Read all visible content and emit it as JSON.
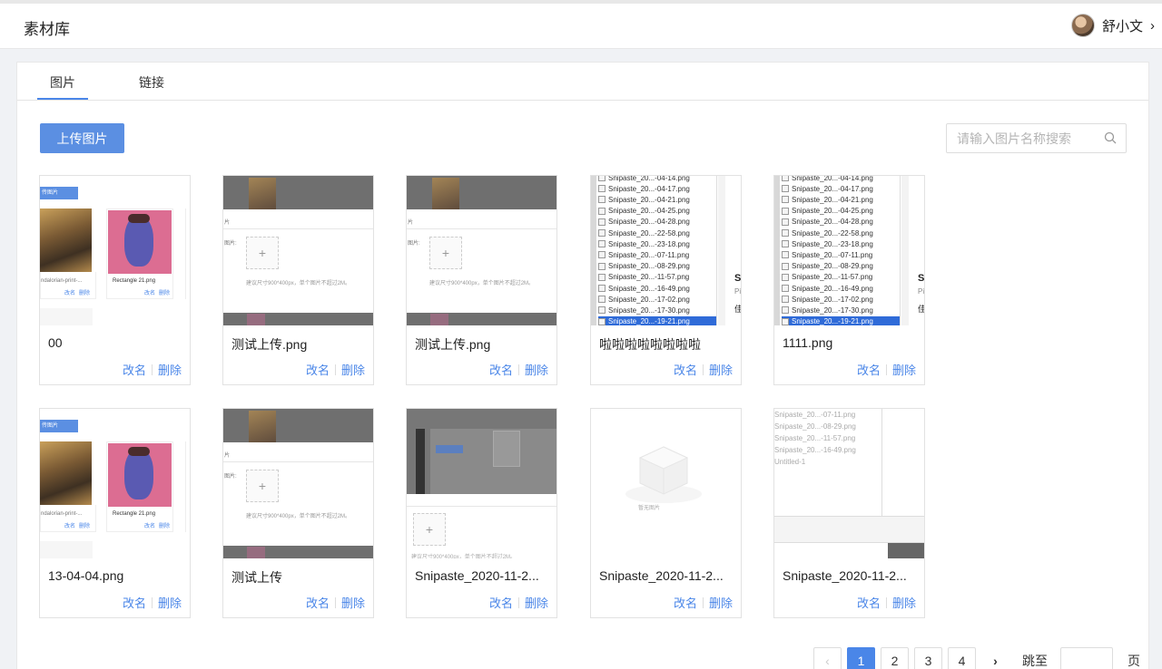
{
  "app": {
    "title": "素材库"
  },
  "user": {
    "name": "舒小文"
  },
  "tabs": [
    {
      "label": "图片"
    },
    {
      "label": "链接"
    }
  ],
  "toolbar": {
    "upload_label": "上传图片"
  },
  "search": {
    "placeholder": "请输入图片名称搜索"
  },
  "actions": {
    "rename": "改名",
    "delete": "删除"
  },
  "cards": [
    {
      "name": "00"
    },
    {
      "name": "测试上传.png"
    },
    {
      "name": "测试上传.png"
    },
    {
      "name": "啦啦啦啦啦啦啦啦"
    },
    {
      "name": "1111.png"
    },
    {
      "name": "13-04-04.png"
    },
    {
      "name": "测试上传"
    },
    {
      "name": "Snipaste_2020-11-2..."
    },
    {
      "name": "Snipaste_2020-11-2..."
    },
    {
      "name": "Snipaste_2020-11-2..."
    }
  ],
  "thumb_text": {
    "upload_chip": "传图片",
    "caption_mandalorian": "ndalorian-print-...",
    "caption_rectangle": "Rectangle 21.png",
    "mini_rename": "改名",
    "mini_delete": "删除",
    "label_pictures": "图片:",
    "label_pic": "片",
    "size_hint": "建议尺寸900*400px，单个图片不超过2M。",
    "empty_state": "暂无图片",
    "plus": "+",
    "file_list": [
      "Snipaste_20...-04-14.png",
      "Snipaste_20...-04-17.png",
      "Snipaste_20...-04-21.png",
      "Snipaste_20...-04-25.png",
      "Snipaste_20...-04-28.png",
      "Snipaste_20...-22-58.png",
      "Snipaste_20...-23-18.png",
      "Snipaste_20...-07-11.png",
      "Snipaste_20...-08-29.png",
      "Snipaste_20...-11-57.png",
      "Snipaste_20...-16-49.png",
      "Snipaste_20...-17-02.png",
      "Snipaste_20...-17-30.png",
      "Snipaste_20...-19-21.png"
    ],
    "file_list_short": [
      "Snipaste_20...-07-11.png",
      "Snipaste_20...-08-29.png",
      "Snipaste_20...-11-57.png",
      "Snipaste_20...-16-49.png",
      "Untitled-1"
    ]
  },
  "pagination": {
    "prev": "‹",
    "next": "›",
    "pages": [
      "1",
      "2",
      "3",
      "4"
    ],
    "current": "1",
    "jump_label": "跳至",
    "unit": "页"
  }
}
